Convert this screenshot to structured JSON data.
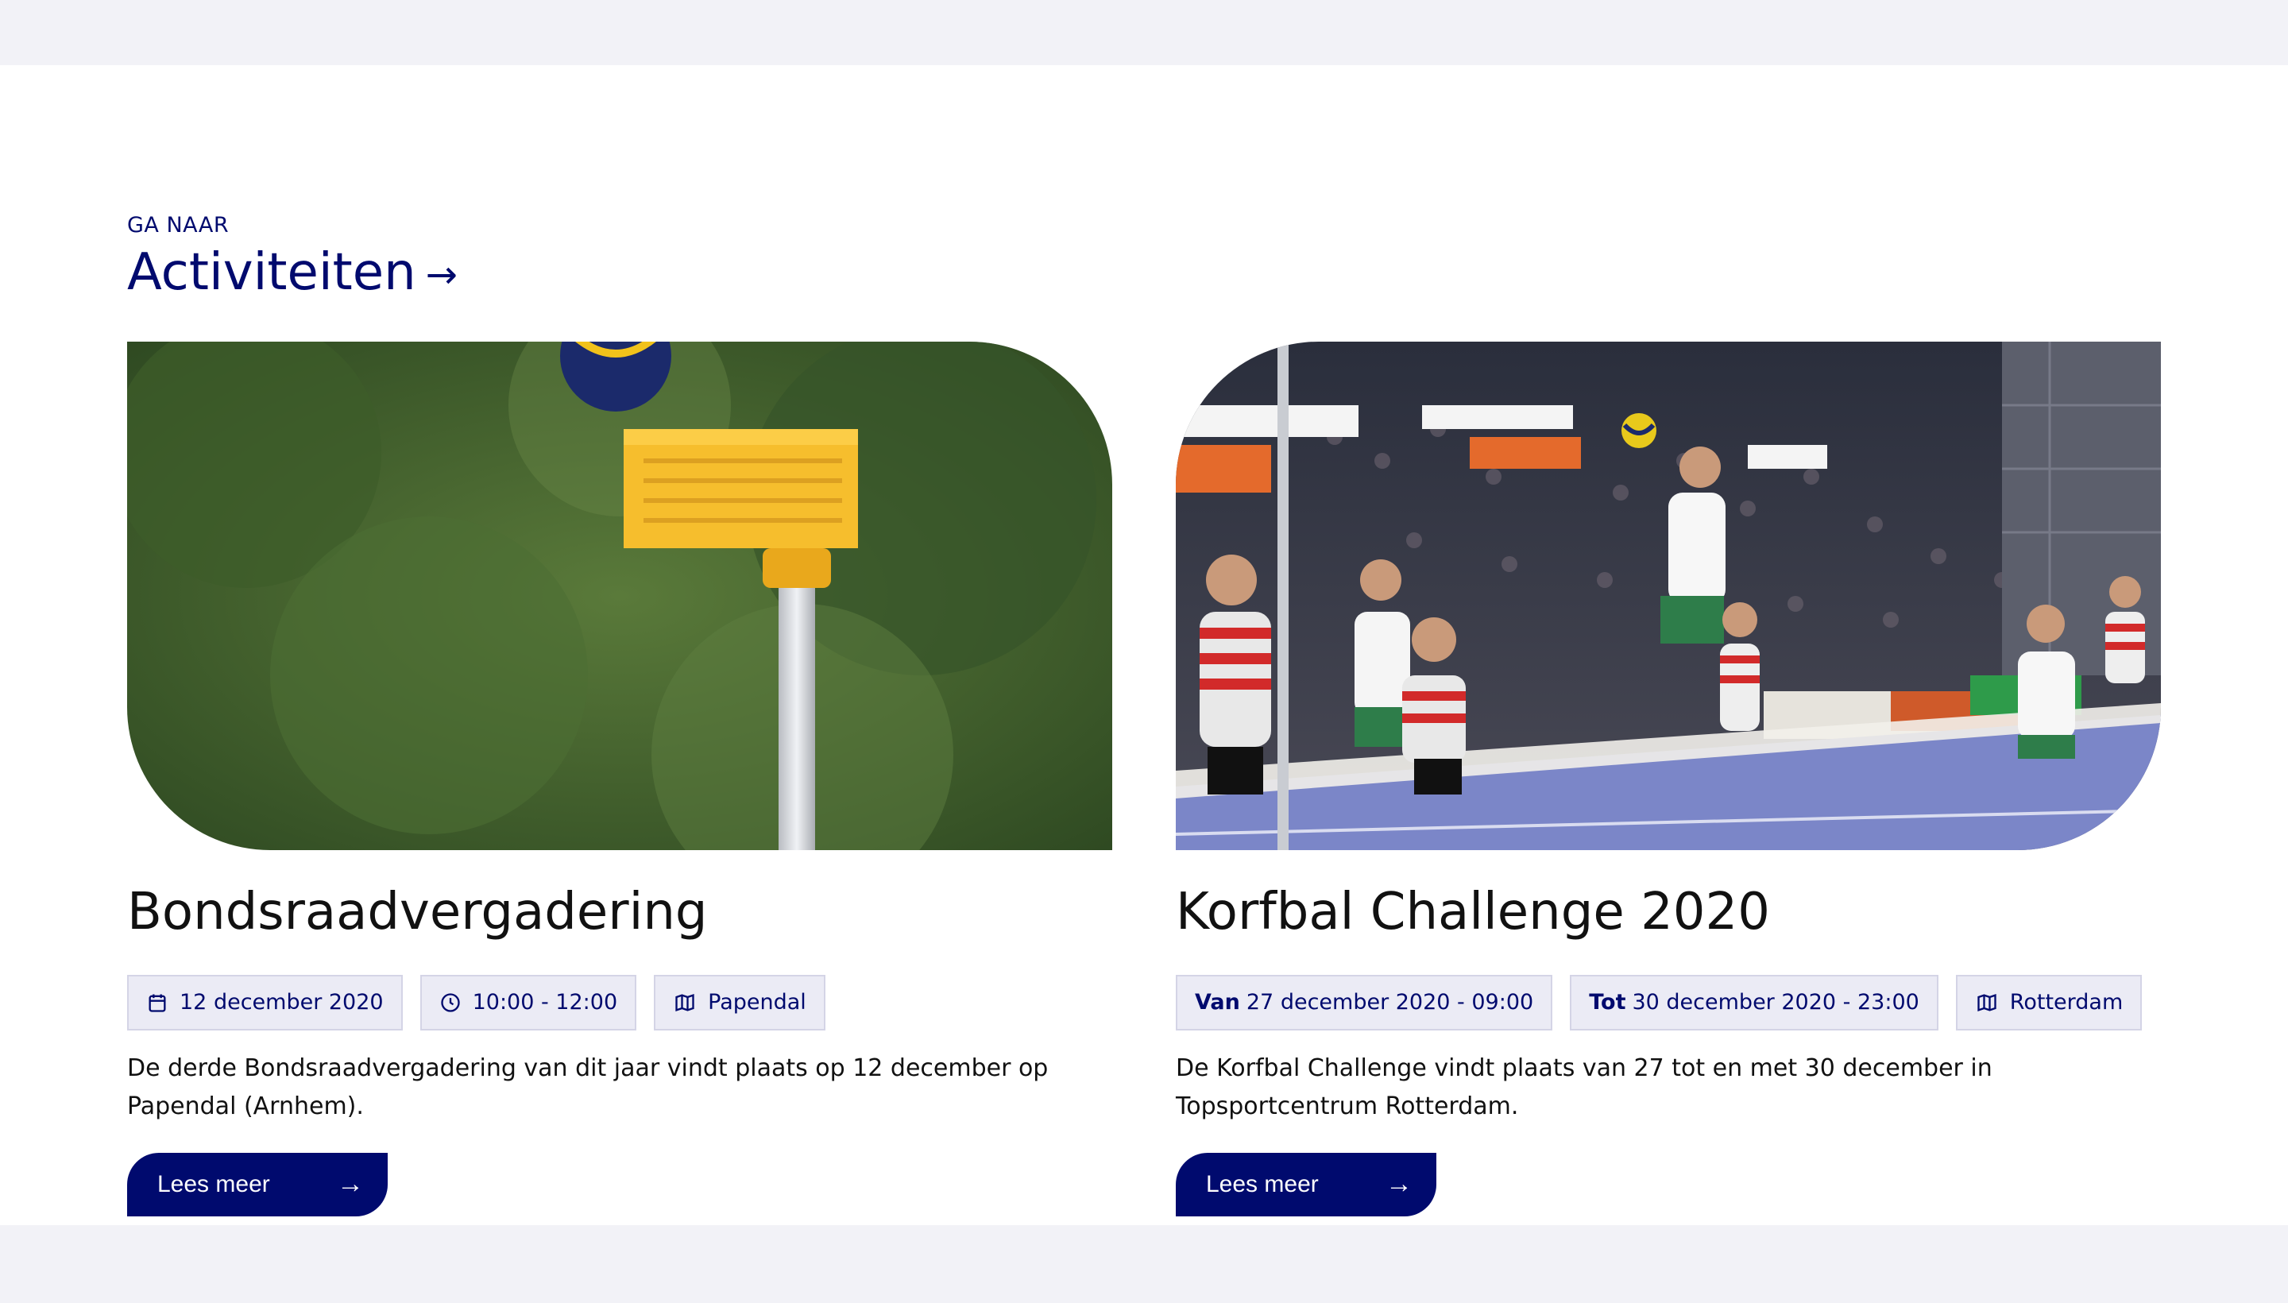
{
  "section": {
    "eyebrow": "GA NAAR",
    "heading": "Activiteiten",
    "heading_arrow": "→"
  },
  "cards": [
    {
      "title": "Bondsraadvergadering",
      "date": "12 december 2020",
      "time": "10:00 - 12:00",
      "location": "Papendal",
      "description": "De derde Bondsraadvergadering van dit jaar vindt plaats op 12 december op Papendal (Arnhem).",
      "button": "Lees meer",
      "button_arrow": "→",
      "image": "korfball-basket-photo"
    },
    {
      "title": "Korfbal Challenge 2020",
      "from_label": "Van",
      "from": "27 december 2020 - 09:00",
      "to_label": "Tot",
      "to": "30 december 2020 - 23:00",
      "location": "Rotterdam",
      "description": "De Korfbal Challenge vindt plaats van 27 tot en met 30 december in Topsportcentrum Rotterdam.",
      "button": "Lees meer",
      "button_arrow": "→",
      "image": "korfball-match-photo"
    }
  ],
  "colors": {
    "brand": "#000a6e",
    "chip_bg": "#ebebf5",
    "page_bg": "#f2f2f7"
  },
  "icons": [
    "calendar-icon",
    "clock-icon",
    "map-icon",
    "arrow-right-icon"
  ]
}
